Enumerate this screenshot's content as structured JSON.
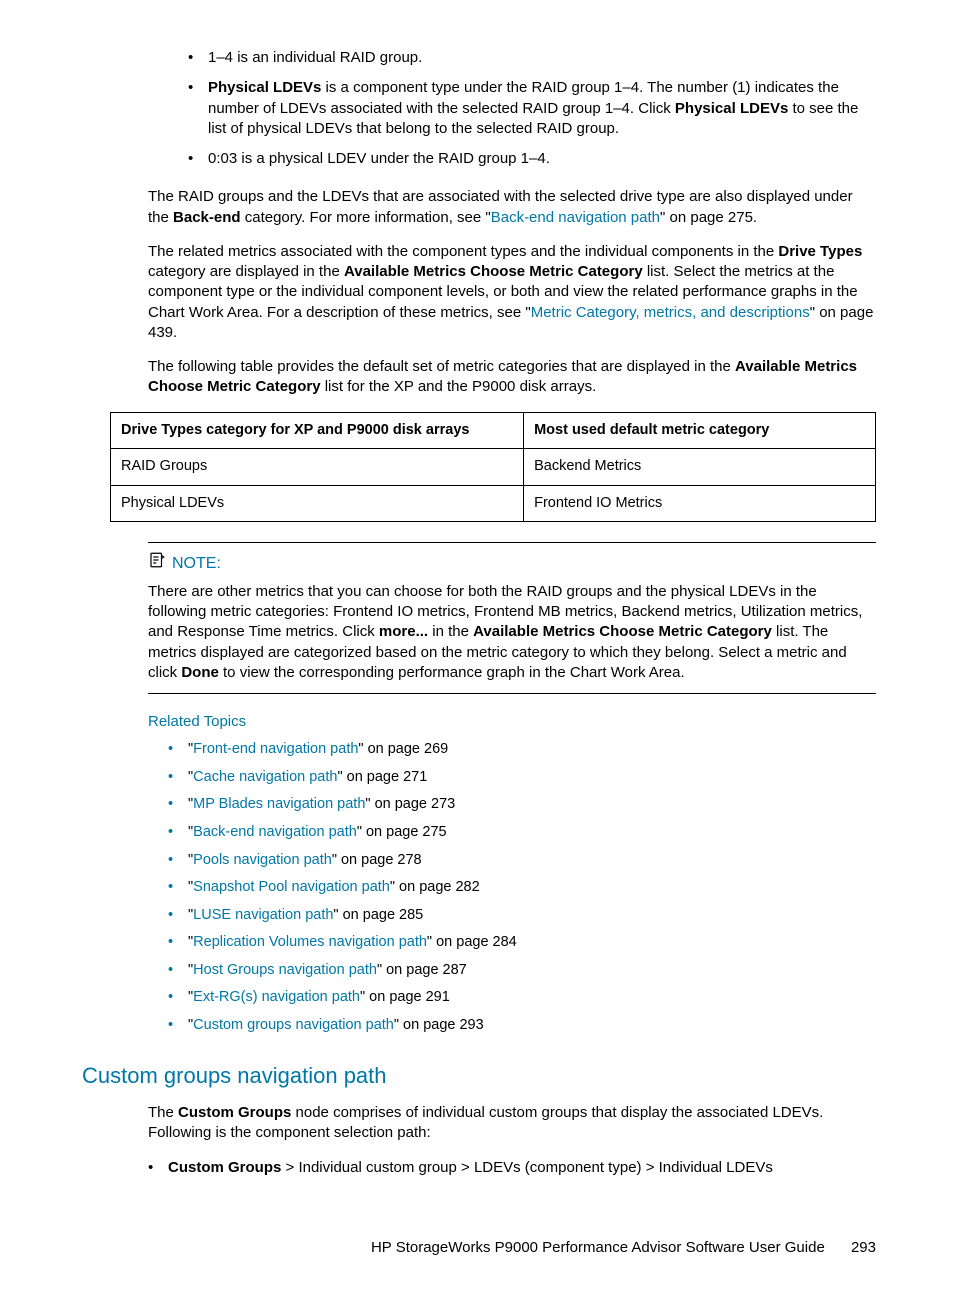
{
  "top_bullets": [
    {
      "pre": "1–4 is an individual RAID group."
    },
    {
      "pre": "",
      "bold1": "Physical LDEVs",
      "mid": " is a component type under the RAID group 1–4. The number (1) indicates the number of LDEVs associated with the selected RAID group 1–4. Click ",
      "bold2": "Physical LDEVs",
      "post": " to see the list of physical LDEVs that belong to the selected RAID group."
    },
    {
      "pre": "0:03 is a physical LDEV under the RAID group 1–4."
    }
  ],
  "para1": {
    "t1": "The RAID groups and the LDEVs that are associated with the selected drive type are also displayed under the ",
    "b1": "Back-end",
    "t2": " category. For more information, see \"",
    "link": "Back-end navigation path",
    "t3": "\" on page 275."
  },
  "para2": {
    "t1": "The related metrics associated with the component types and the individual components in the ",
    "b1": "Drive Types",
    "t2": " category are displayed in the ",
    "b2": "Available Metrics Choose Metric Category",
    "t3": " list. Select the metrics at the component type or the individual component levels, or both and view the related performance graphs in the Chart Work Area. For a description of these metrics, see \"",
    "link": "Metric Category, metrics, and descriptions",
    "t4": "\" on page 439."
  },
  "para3": {
    "t1": "The following table provides the default set of metric categories that are displayed in the ",
    "b1": "Available Metrics Choose Metric Category",
    "t2": " list for the XP and the P9000 disk arrays."
  },
  "table": {
    "h1": "Drive Types category for XP and P9000 disk arrays",
    "h2": "Most used default metric category",
    "rows": [
      {
        "c1": "RAID Groups",
        "c2": "Backend Metrics"
      },
      {
        "c1": "Physical LDEVs",
        "c2": "Frontend IO Metrics"
      }
    ]
  },
  "note": {
    "label": "NOTE:",
    "t1": "There are other metrics that you can choose for both the RAID groups and the physical LDEVs in the following metric categories: Frontend IO metrics, Frontend MB metrics, Backend metrics, Utilization metrics, and Response Time metrics. Click ",
    "b1": "more...",
    "t2": " in the ",
    "b2": "Available Metrics Choose Metric Category",
    "t3": " list. The metrics displayed are categorized based on the metric category to which they belong. Select a metric and click ",
    "b3": "Done",
    "t4": " to view the corresponding performance graph in the Chart Work Area."
  },
  "related_label": "Related Topics",
  "related": [
    {
      "q1": "\"",
      "link": "Front-end navigation path",
      "q2": "\" on page 269"
    },
    {
      "q1": "\"",
      "link": "Cache navigation path",
      "q2": "\" on page 271"
    },
    {
      "q1": "\"",
      "link": "MP Blades navigation path",
      "q2": "\" on page 273"
    },
    {
      "q1": "\"",
      "link": "Back-end navigation path",
      "q2": "\" on page 275"
    },
    {
      "q1": "\"",
      "link": "Pools navigation path",
      "q2": "\" on page 278"
    },
    {
      "q1": "\"",
      "link": "Snapshot Pool navigation path",
      "q2": "\" on page 282"
    },
    {
      "q1": "\"",
      "link": "LUSE navigation path",
      "q2": "\" on page 285"
    },
    {
      "q1": "\"",
      "link": "Replication Volumes navigation path",
      "q2": "\" on page 284"
    },
    {
      "q1": "\"",
      "link": "Host Groups navigation path",
      "q2": "\" on page 287"
    },
    {
      "q1": "\"",
      "link": "Ext-RG(s) navigation path",
      "q2": "\" on page 291"
    },
    {
      "q1": "\"",
      "link": "Custom groups navigation path",
      "q2": "\" on page 293"
    }
  ],
  "section_heading": "Custom groups navigation path",
  "sec_para": {
    "t1": "The ",
    "b1": "Custom Groups",
    "t2": " node comprises of individual custom groups that display the associated LDEVs. Following is the component selection path:"
  },
  "sec_bullet": {
    "b1": "Custom Groups",
    "t1": " > Individual custom group > LDEVs (component type) > Individual LDEVs"
  },
  "footer": {
    "title": "HP StorageWorks P9000 Performance Advisor Software User Guide",
    "page": "293"
  }
}
